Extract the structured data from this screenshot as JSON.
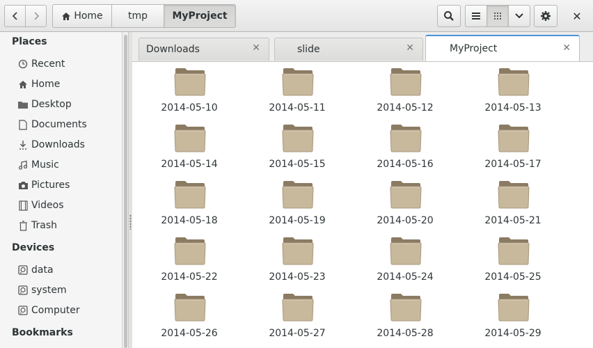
{
  "header": {
    "breadcrumbs": [
      {
        "label": "Home",
        "icon": "home-icon"
      },
      {
        "label": "tmp"
      },
      {
        "label": "MyProject"
      }
    ],
    "close_glyph": "✕"
  },
  "sidebar": {
    "places_title": "Places",
    "places": [
      {
        "label": "Recent",
        "icon": "clock-icon"
      },
      {
        "label": "Home",
        "icon": "home-icon"
      },
      {
        "label": "Desktop",
        "icon": "folder-icon"
      },
      {
        "label": "Documents",
        "icon": "document-icon"
      },
      {
        "label": "Downloads",
        "icon": "download-icon"
      },
      {
        "label": "Music",
        "icon": "music-icon"
      },
      {
        "label": "Pictures",
        "icon": "camera-icon"
      },
      {
        "label": "Videos",
        "icon": "film-icon"
      },
      {
        "label": "Trash",
        "icon": "trash-icon"
      }
    ],
    "devices_title": "Devices",
    "devices": [
      {
        "label": "data",
        "icon": "drive-icon"
      },
      {
        "label": "system",
        "icon": "drive-icon"
      },
      {
        "label": "Computer",
        "icon": "drive-icon"
      }
    ],
    "bookmarks_title": "Bookmarks"
  },
  "tabs": [
    {
      "label": "Downloads",
      "active": false
    },
    {
      "label": "slide",
      "active": false
    },
    {
      "label": "MyProject",
      "active": true
    }
  ],
  "files": [
    "2014-05-10",
    "2014-05-11",
    "2014-05-12",
    "2014-05-13",
    "2014-05-14",
    "2014-05-15",
    "2014-05-16",
    "2014-05-17",
    "2014-05-18",
    "2014-05-19",
    "2014-05-20",
    "2014-05-21",
    "2014-05-22",
    "2014-05-23",
    "2014-05-24",
    "2014-05-25",
    "2014-05-26",
    "2014-05-27",
    "2014-05-28",
    "2014-05-29"
  ],
  "colors": {
    "accent": "#4a90d9",
    "folder_body": "#c8b89c",
    "folder_tab": "#8b7b62"
  }
}
